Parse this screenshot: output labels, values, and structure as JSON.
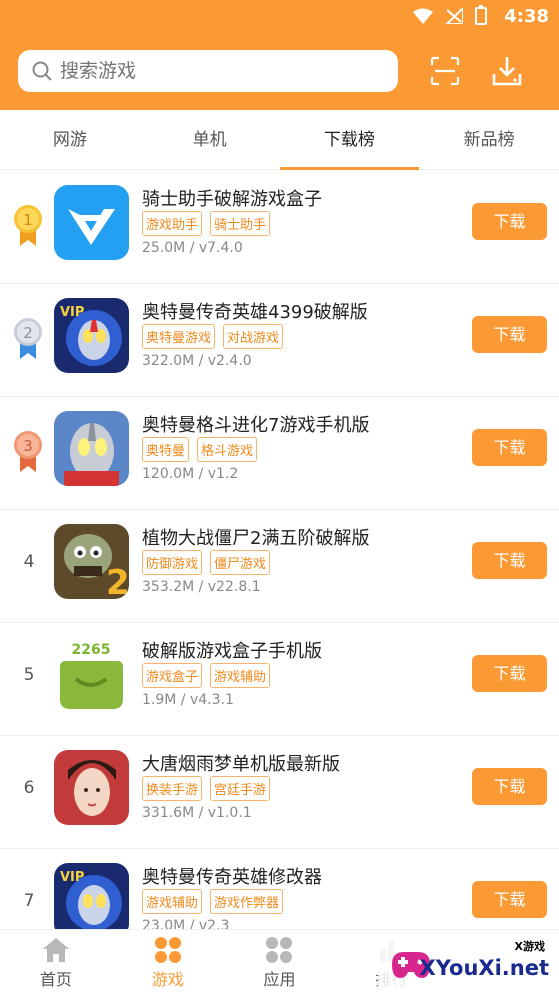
{
  "status": {
    "time": "4:38"
  },
  "search": {
    "placeholder": "搜索游戏"
  },
  "tabs": [
    {
      "label": "网游"
    },
    {
      "label": "单机"
    },
    {
      "label": "下载榜",
      "active": true
    },
    {
      "label": "新品榜"
    }
  ],
  "apps": [
    {
      "rank": "1",
      "title": "骑士助手破解游戏盒子",
      "tags": [
        "游戏助手",
        "骑士助手"
      ],
      "meta": "25.0M / v7.4.0",
      "button": "下载"
    },
    {
      "rank": "2",
      "title": "奥特曼传奇英雄4399破解版",
      "tags": [
        "奥特曼游戏",
        "对战游戏"
      ],
      "meta": "322.0M / v2.4.0",
      "button": "下载"
    },
    {
      "rank": "3",
      "title": "奥特曼格斗进化7游戏手机版",
      "tags": [
        "奥特曼",
        "格斗游戏"
      ],
      "meta": "120.0M / v1.2",
      "button": "下载"
    },
    {
      "rank": "4",
      "title": "植物大战僵尸2满五阶破解版",
      "tags": [
        "防御游戏",
        "僵尸游戏"
      ],
      "meta": "353.2M / v22.8.1",
      "button": "下载"
    },
    {
      "rank": "5",
      "title": "破解版游戏盒子手机版",
      "tags": [
        "游戏盒子",
        "游戏辅助"
      ],
      "meta": "1.9M / v4.3.1",
      "button": "下载"
    },
    {
      "rank": "6",
      "title": "大唐烟雨梦单机版最新版",
      "tags": [
        "换装手游",
        "宫廷手游"
      ],
      "meta": "331.6M / v1.0.1",
      "button": "下载"
    },
    {
      "rank": "7",
      "title": "奥特曼传奇英雄修改器",
      "tags": [
        "游戏辅助",
        "游戏作弊器"
      ],
      "meta": "23.0M / v2.3",
      "button": "下载"
    }
  ],
  "icons": {
    "app5_logo_text": "2265",
    "app2_badge": "VIP",
    "app7_badge": "VIP"
  },
  "bottom_nav": [
    {
      "label": "首页"
    },
    {
      "label": "游戏",
      "active": true
    },
    {
      "label": "应用"
    },
    {
      "label": "排行"
    }
  ],
  "watermark": {
    "brand": "XYouXi.net",
    "small": "X游戏"
  },
  "colors": {
    "accent": "#fb9a34",
    "tag_border": "#f5b46c",
    "tag_text": "#f08a1c"
  }
}
